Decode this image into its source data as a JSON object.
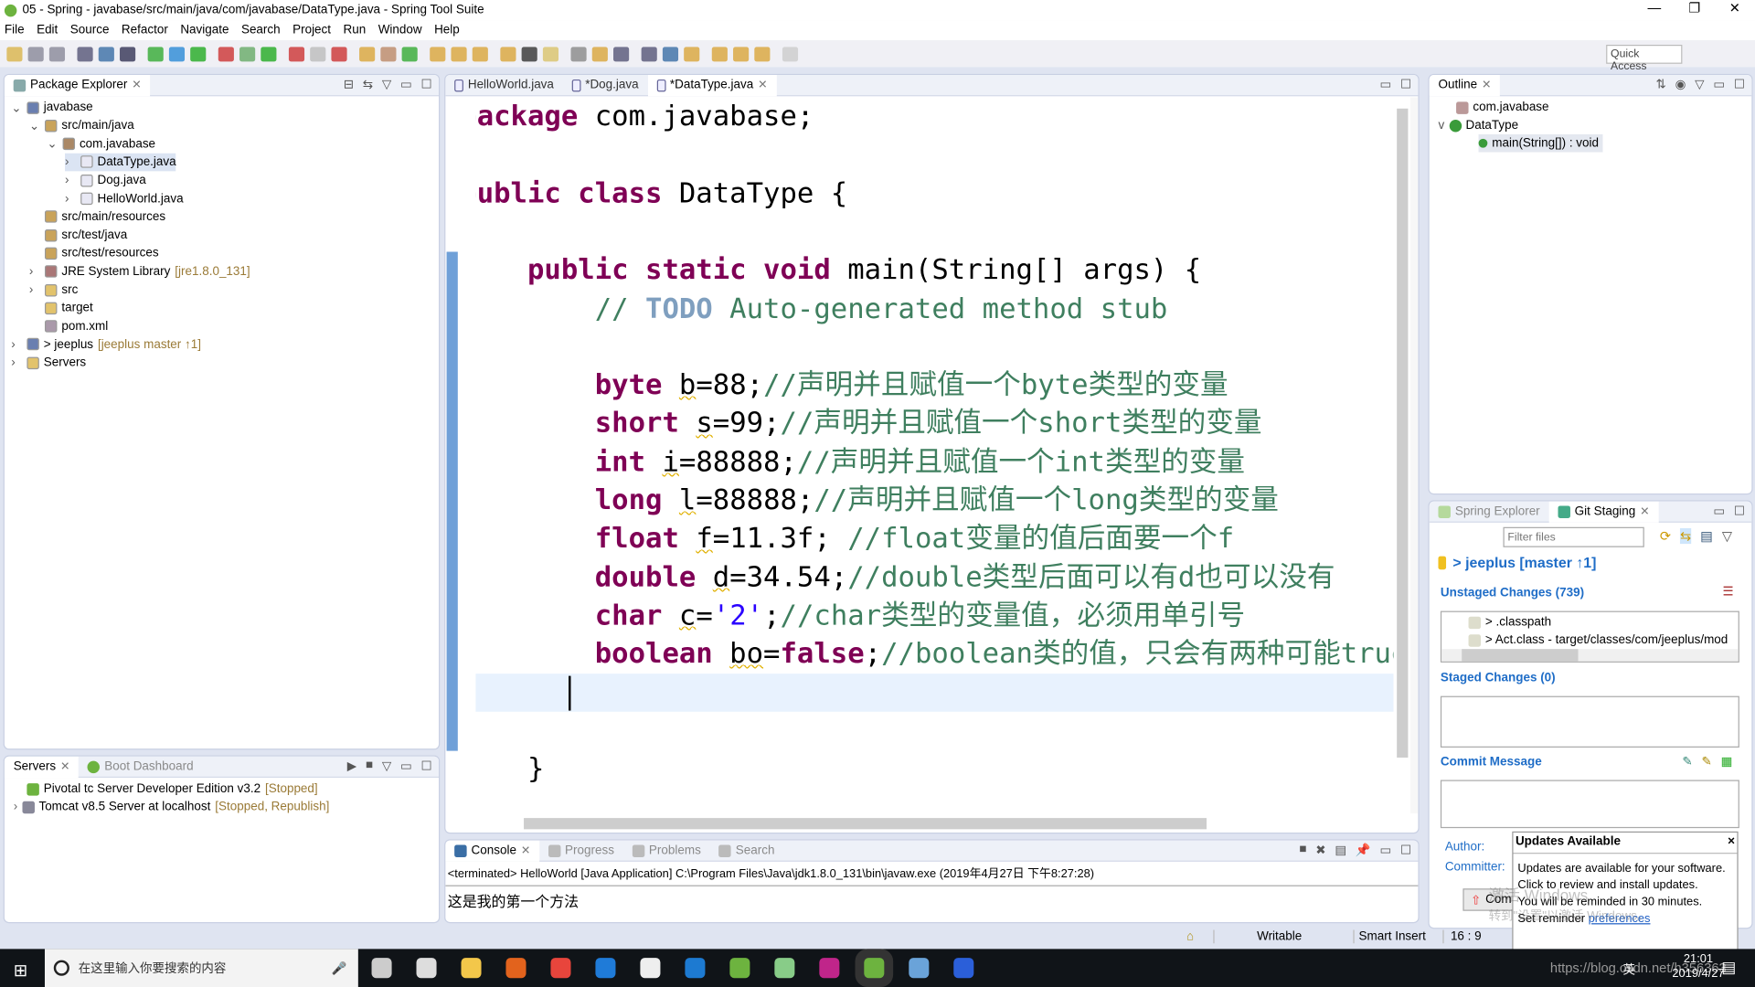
{
  "window": {
    "title": "05 - Spring - javabase/src/main/java/com/javabase/DataType.java - Spring Tool Suite",
    "controls": [
      "—",
      "❐",
      "✕"
    ]
  },
  "menu": [
    "File",
    "Edit",
    "Source",
    "Refactor",
    "Navigate",
    "Search",
    "Project",
    "Run",
    "Window",
    "Help"
  ],
  "toolbar": {
    "quick_access": "Quick Access"
  },
  "package_explorer": {
    "tab": "Package Explorer",
    "items": [
      {
        "label": "javabase",
        "depth": 0,
        "arrow": "v",
        "icon": "project-icon",
        "deco": ""
      },
      {
        "label": "src/main/java",
        "depth": 1,
        "arrow": "v",
        "icon": "source-folder-icon",
        "deco": ""
      },
      {
        "label": "com.javabase",
        "depth": 2,
        "arrow": "v",
        "icon": "package-icon",
        "deco": ""
      },
      {
        "label": "DataType.java",
        "depth": 3,
        "arrow": ">",
        "icon": "java-file-icon",
        "deco": "",
        "selected": true
      },
      {
        "label": "Dog.java",
        "depth": 3,
        "arrow": ">",
        "icon": "java-file-icon",
        "deco": ""
      },
      {
        "label": "HelloWorld.java",
        "depth": 3,
        "arrow": ">",
        "icon": "java-file-icon",
        "deco": ""
      },
      {
        "label": "src/main/resources",
        "depth": 1,
        "arrow": "",
        "icon": "source-folder-icon",
        "deco": ""
      },
      {
        "label": "src/test/java",
        "depth": 1,
        "arrow": "",
        "icon": "source-folder-icon",
        "deco": ""
      },
      {
        "label": "src/test/resources",
        "depth": 1,
        "arrow": "",
        "icon": "source-folder-icon",
        "deco": ""
      },
      {
        "label": "JRE System Library",
        "depth": 1,
        "arrow": ">",
        "icon": "library-icon",
        "deco": "[jre1.8.0_131]"
      },
      {
        "label": "src",
        "depth": 1,
        "arrow": ">",
        "icon": "folder-icon",
        "deco": ""
      },
      {
        "label": "target",
        "depth": 1,
        "arrow": "",
        "icon": "folder-icon",
        "deco": ""
      },
      {
        "label": "pom.xml",
        "depth": 1,
        "arrow": "",
        "icon": "xml-file-icon",
        "deco": ""
      },
      {
        "label": "> jeeplus",
        "depth": 0,
        "arrow": ">",
        "icon": "project-icon",
        "deco": "[jeeplus master ↑1]"
      },
      {
        "label": "Servers",
        "depth": 0,
        "arrow": ">",
        "icon": "folder-icon",
        "deco": ""
      }
    ]
  },
  "servers": {
    "tabs": [
      "Servers",
      "Boot Dashboard"
    ],
    "items": [
      {
        "label": "Pivotal tc Server Developer Edition v3.2",
        "status": "[Stopped]"
      },
      {
        "label": "Tomcat v8.5 Server at localhost",
        "status": "[Stopped, Republish]"
      }
    ]
  },
  "editor": {
    "tabs": [
      {
        "label": "HelloWorld.java",
        "active": false
      },
      {
        "label": "*Dog.java",
        "active": false
      },
      {
        "label": "*DataType.java",
        "active": true
      }
    ],
    "lines": [
      [
        {
          "c": "kw",
          "v": "package"
        },
        {
          "c": "",
          "v": " com.javabase;"
        }
      ],
      [],
      [
        {
          "c": "kw",
          "v": "public class"
        },
        {
          "c": "",
          "v": " DataType {"
        }
      ],
      [],
      [
        {
          "c": "",
          "v": "    "
        },
        {
          "c": "kw",
          "v": "public static void"
        },
        {
          "c": "",
          "v": " main(String[] args) {"
        }
      ],
      [
        {
          "c": "cm",
          "v": "        // "
        },
        {
          "c": "todo",
          "v": "TODO"
        },
        {
          "c": "cm",
          "v": " Auto-generated method stub"
        }
      ],
      [],
      [
        {
          "c": "",
          "v": "        "
        },
        {
          "c": "kw",
          "v": "byte"
        },
        {
          "c": "",
          "v": " "
        },
        {
          "c": "var",
          "v": "b"
        },
        {
          "c": "",
          "v": "=88;"
        },
        {
          "c": "cm",
          "v": "//声明并且赋值一个byte类型的变量"
        }
      ],
      [
        {
          "c": "",
          "v": "        "
        },
        {
          "c": "kw",
          "v": "short"
        },
        {
          "c": "",
          "v": " "
        },
        {
          "c": "var",
          "v": "s"
        },
        {
          "c": "",
          "v": "=99;"
        },
        {
          "c": "cm",
          "v": "//声明并且赋值一个short类型的变量"
        }
      ],
      [
        {
          "c": "",
          "v": "        "
        },
        {
          "c": "kw",
          "v": "int"
        },
        {
          "c": "",
          "v": " "
        },
        {
          "c": "var",
          "v": "i"
        },
        {
          "c": "",
          "v": "=88888;"
        },
        {
          "c": "cm",
          "v": "//声明并且赋值一个int类型的变量"
        }
      ],
      [
        {
          "c": "",
          "v": "        "
        },
        {
          "c": "kw",
          "v": "long"
        },
        {
          "c": "",
          "v": " "
        },
        {
          "c": "var",
          "v": "l"
        },
        {
          "c": "",
          "v": "=88888;"
        },
        {
          "c": "cm",
          "v": "//声明并且赋值一个long类型的变量"
        }
      ],
      [
        {
          "c": "",
          "v": "        "
        },
        {
          "c": "kw",
          "v": "float"
        },
        {
          "c": "",
          "v": " "
        },
        {
          "c": "var",
          "v": "f"
        },
        {
          "c": "",
          "v": "=11.3f; "
        },
        {
          "c": "cm",
          "v": "//float变量的值后面要一个f"
        }
      ],
      [
        {
          "c": "",
          "v": "        "
        },
        {
          "c": "kw",
          "v": "double"
        },
        {
          "c": "",
          "v": " "
        },
        {
          "c": "var",
          "v": "d"
        },
        {
          "c": "",
          "v": "=34.54;"
        },
        {
          "c": "cm",
          "v": "//double类型后面可以有d也可以没有"
        }
      ],
      [
        {
          "c": "",
          "v": "        "
        },
        {
          "c": "kw",
          "v": "char"
        },
        {
          "c": "",
          "v": " "
        },
        {
          "c": "var",
          "v": "c"
        },
        {
          "c": "",
          "v": "="
        },
        {
          "c": "st",
          "v": "'2'"
        },
        {
          "c": "",
          "v": ";"
        },
        {
          "c": "cm",
          "v": "//char类型的变量值，必须用单引号"
        }
      ],
      [
        {
          "c": "",
          "v": "        "
        },
        {
          "c": "kw",
          "v": "boolean"
        },
        {
          "c": "",
          "v": " "
        },
        {
          "c": "var",
          "v": "bo"
        },
        {
          "c": "",
          "v": "="
        },
        {
          "c": "kw",
          "v": "false"
        },
        {
          "c": "",
          "v": ";"
        },
        {
          "c": "cm",
          "v": "//boolean类的值，只会有两种可能true"
        }
      ],
      [
        {
          "c": "",
          "v": "        "
        }
      ],
      [],
      [
        {
          "c": "",
          "v": "    }"
        }
      ]
    ]
  },
  "console": {
    "tabs": [
      "Console",
      "Progress",
      "Problems",
      "Search"
    ],
    "header": "<terminated> HelloWorld [Java Application] C:\\Program Files\\Java\\jdk1.8.0_131\\bin\\javaw.exe (2019年4月27日 下午8:27:28)",
    "output": "这是我的第一个方法"
  },
  "outline": {
    "tab": "Outline",
    "items": [
      "com.javabase",
      "DataType",
      "main(String[]) : void"
    ]
  },
  "git": {
    "tabs": [
      "Spring Explorer",
      "Git Staging"
    ],
    "filter_placeholder": "Filter files",
    "repo": "> jeeplus [master ↑1]",
    "unstaged_title": "Unstaged Changes (739)",
    "unstaged": [
      "> .classpath",
      "> Act.class - target/classes/com/jeeplus/mod"
    ],
    "staged_title": "Staged Changes (0)",
    "commit_title": "Commit Message",
    "author_label": "Author:",
    "committer_label": "Committer:",
    "commit_button": "Com"
  },
  "popup": {
    "title": "Updates Available",
    "close": "×",
    "lines": [
      "Updates are available for your software.",
      "Click to review and install updates.",
      "You will be reminded in 30 minutes."
    ],
    "reminder_prefix": "Set reminder ",
    "reminder_link": "preferences"
  },
  "statusbar": {
    "mode": "Writable",
    "insert": "Smart Insert",
    "position": "16 : 9"
  },
  "taskbar": {
    "search_placeholder": "在这里输入你要搜索的内容",
    "time": "21:01",
    "date": "2019/4/27",
    "ime": "英"
  },
  "watermark": {
    "line1": "激活 Windows",
    "line2": "转到\"设置\"以激活 Windows。",
    "url": "https://blog.csdn.net/h356363"
  }
}
